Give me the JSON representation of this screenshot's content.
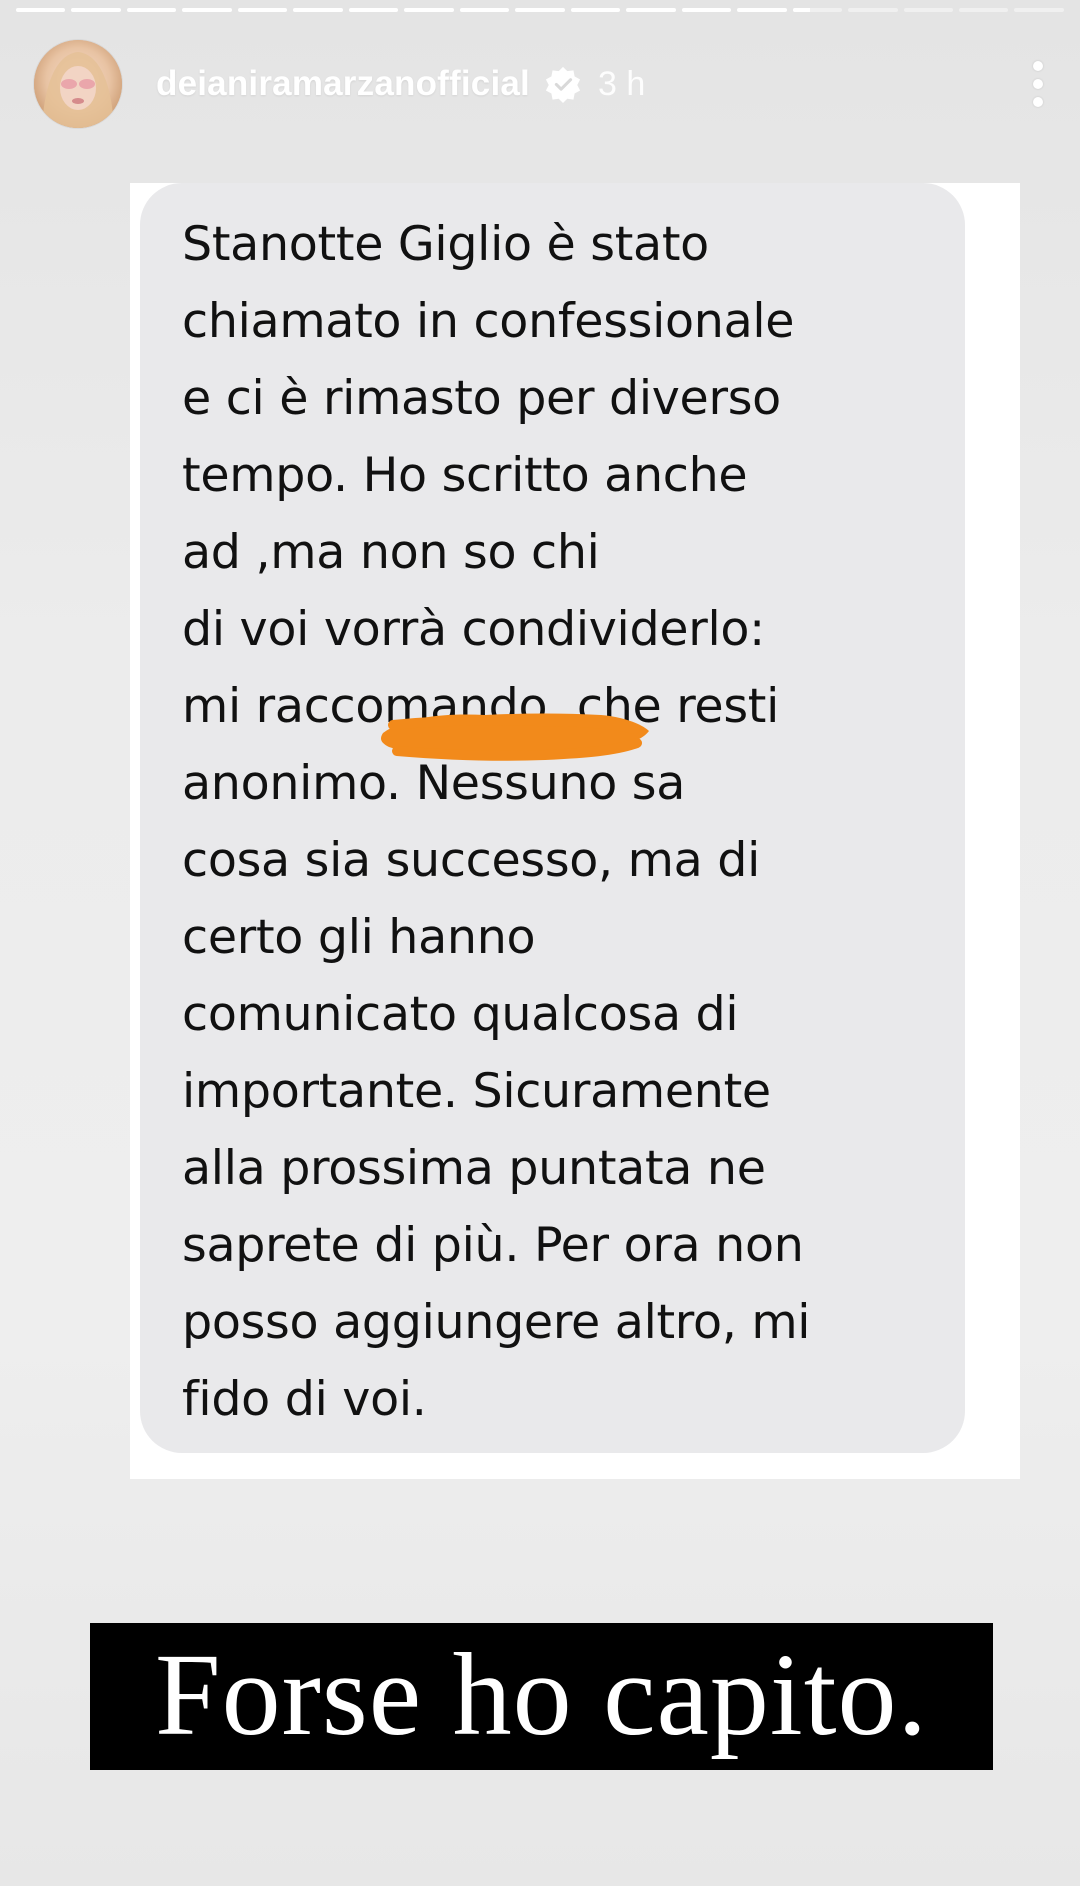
{
  "story": {
    "progress_segments": 19,
    "active_segment_index": 14,
    "active_segment_progress": 0.35
  },
  "header": {
    "username": "deianiramarzanofficial",
    "time": "3 h",
    "icons": {
      "avatar": "profile-avatar",
      "verified": "verified-badge-icon",
      "more": "more-vertical-icon"
    }
  },
  "message": {
    "text": "Stanotte Giglio è stato\nchiamato in confessionale\ne ci è rimasto per diverso\ntempo. Ho scritto anche\nad                    ,ma non so chi\ndi voi vorrà condividerlo:\nmi raccomando, che resti\nanonimo. Nessuno sa\ncosa sia successo, ma di\ncerto gli hanno\ncomunicato qualcosa di\nimportante. Sicuramente\nalla prossima puntata ne\nsaprete di più. Per ora non\nposso aggiungere altro, mi\nfido di voi.",
    "redaction_color": "#f28a1b"
  },
  "caption": {
    "text": "Forse ho capito."
  },
  "colors": {
    "bubble": "#e9e9eb",
    "caption_bg": "#000000",
    "caption_text": "#ffffff"
  }
}
